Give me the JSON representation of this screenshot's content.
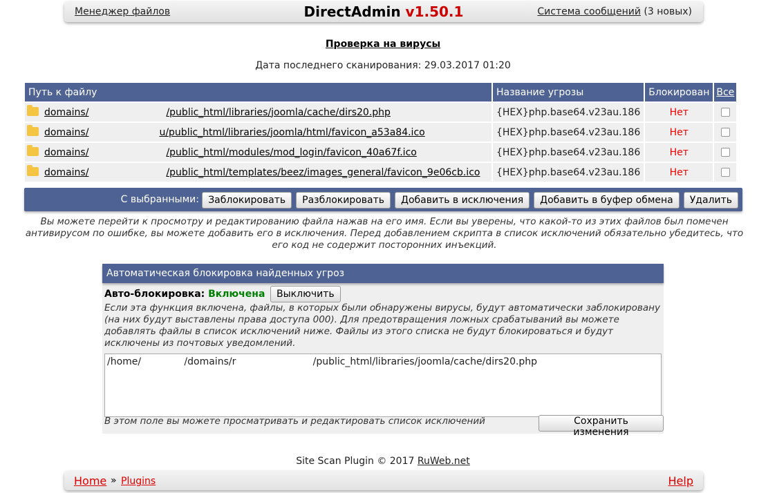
{
  "top": {
    "file_manager": "Менеджер файлов",
    "brand": "DirectAdmin",
    "version": "v1.50.1",
    "messages_link": "Система сообщений",
    "messages_count": "(3 новых)"
  },
  "page_title": "Проверка на вирусы",
  "last_scan": "Дата последнего сканирования: 29.03.2017 01:20",
  "table": {
    "headers": {
      "path": "Путь к файлу",
      "threat": "Название угрозы",
      "blocked": "Блокирован",
      "all": "Все"
    },
    "rows": [
      {
        "path_prefix": "domains/",
        "path_suffix": "/public_html/libraries/joomla/cache/dirs20.php",
        "threat": "{HEX}php.base64.v23au.186",
        "blocked": "Нет"
      },
      {
        "path_prefix": "domains/",
        "path_suffix": "u/public_html/libraries/joomla/html/favicon_a53a84.ico",
        "threat": "{HEX}php.base64.v23au.186",
        "blocked": "Нет"
      },
      {
        "path_prefix": "domains/",
        "path_suffix": "/public_html/modules/mod_login/favicon_40a67f.ico",
        "threat": "{HEX}php.base64.v23au.186",
        "blocked": "Нет"
      },
      {
        "path_prefix": "domains/",
        "path_suffix": "/public_html/templates/beez/images_general/favicon_9e06cb.ico",
        "threat": "{HEX}php.base64.v23au.186",
        "blocked": "Нет"
      }
    ]
  },
  "actions": {
    "label": "С выбранными:",
    "block": "Заблокировать",
    "unblock": "Разблокировать",
    "add_exception": "Добавить в исключения",
    "add_clipboard": "Добавить в буфер обмена",
    "delete": "Удалить"
  },
  "hint": "Вы можете перейти к просмотру и редактированию файла нажав на его имя. Если вы уверены, что какой-то из этих файлов был помечен антивирусом по ошибке, вы можете добавить его в исключения. Перед добавлением скрипта в список исключений обязательно убедитесь, что его код не содержит посторонних инъекций.",
  "auto": {
    "header": "Автоматическая блокировка найденных угроз",
    "label": "Авто-блокировка:",
    "status": "Включена",
    "toggle": "Выключить",
    "description": "Если эта функция включена, файлы, в которых были обнаружены вирусы, будут автоматически заблокировану (на них будут выставлены права доступа 000). Для предотвращения ложных срабатываний вы можете добавлять файлы в список исключений ниже. Файлы из этого списка не будут блокироваться и будут исключены из почтовых уведомлений.",
    "exceptions_text": "/home/              /domains/r                         /public_html/libraries/joomla/cache/dirs20.php",
    "textarea_hint": "В этом поле вы можете просматривать и редактировать список исключений",
    "save": "Сохранить изменения"
  },
  "footer": {
    "text": "Site Scan Plugin © 2017",
    "link": "RuWeb.net"
  },
  "bottom": {
    "home": "Home",
    "separator": "»",
    "plugins": "Plugins",
    "help": "Help"
  },
  "colors": {
    "header_bg": "#4e6393",
    "red": "#dd0000",
    "green": "#008000"
  },
  "icons": {
    "folder": "folder-icon",
    "checkbox": "checkbox"
  }
}
